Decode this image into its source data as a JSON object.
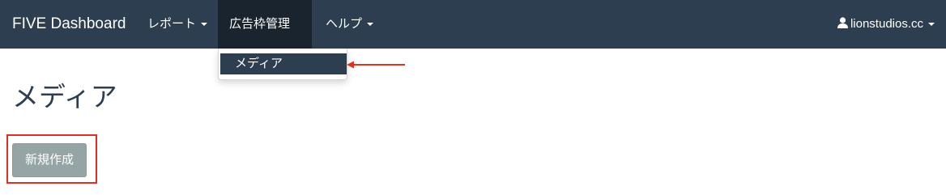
{
  "navbar": {
    "brand": "FIVE Dashboard",
    "items": [
      {
        "label": "レポート"
      },
      {
        "label": "広告枠管理"
      },
      {
        "label": "ヘルプ"
      }
    ],
    "user": {
      "label": "lionstudios.cc",
      "icon": "user-icon"
    },
    "background_color": "#2c3e50"
  },
  "dropdown": {
    "items": [
      {
        "label": "メディア",
        "selected": true
      }
    ]
  },
  "main": {
    "title": "メディア",
    "new_button_label": "新規作成"
  },
  "annotations": {
    "color": "#e0301e"
  }
}
